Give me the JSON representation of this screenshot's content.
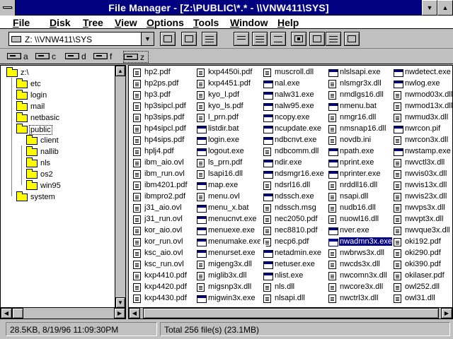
{
  "window": {
    "title": "File Manager - [Z:\\PUBLIC\\*.* - \\\\VNW411\\SYS]"
  },
  "menubar": [
    "File",
    "Disk",
    "Tree",
    "View",
    "Options",
    "Tools",
    "Window",
    "Help"
  ],
  "toolbar": {
    "drive_select_value": "Z: \\\\VNW411\\SYS"
  },
  "drives": [
    "a",
    "c",
    "d",
    "f",
    "z"
  ],
  "tree": [
    {
      "label": "z:\\"
    },
    {
      "label": "etc"
    },
    {
      "label": "login"
    },
    {
      "label": "mail"
    },
    {
      "label": "netbasic"
    },
    {
      "label": "public"
    },
    {
      "label": "client"
    },
    {
      "label": "nallib"
    },
    {
      "label": "nls"
    },
    {
      "label": "os2"
    },
    {
      "label": "win95"
    },
    {
      "label": "system"
    }
  ],
  "files": [
    [
      "hp2.pdf",
      "hp2ps.pdf",
      "hp3.pdf",
      "hp3sipcl.pdf",
      "hp3sips.pdf",
      "hp4sipcl.pdf",
      "hp4sips.pdf",
      "hplj4.pdf",
      "ibm_aio.ovl",
      "ibm_run.ovl",
      "ibm4201.pdf",
      "ibmpro2.pdf",
      "j31_aio.ovl",
      "j31_run.ovl",
      "kor_aio.ovl",
      "kor_run.ovl",
      "ksc_aio.ovl",
      "ksc_run.ovl",
      "kxp4410.pdf",
      "kxp4420.pdf",
      "kxp4430.pdf"
    ],
    [
      "kxp4450i.pdf",
      "kxp4451.pdf",
      "kyo_l.pdf",
      "kyo_ls.pdf",
      "l_prn.pdf",
      "listdir.bat",
      "login.exe",
      "logout.exe",
      "ls_prn.pdf",
      "lsapi16.dll",
      "map.exe",
      "menu.ovl",
      "menu_x.bat",
      "menucnvt.exe",
      "menuexe.exe",
      "menumake.exe",
      "menurset.exe",
      "migeng3x.dll",
      "miglib3x.dll",
      "migsnp3x.dll",
      "migwin3x.exe"
    ],
    [
      "muscroll.dll",
      "nal.exe",
      "nalw31.exe",
      "nalw95.exe",
      "ncopy.exe",
      "ncupdate.exe",
      "ndbcnvt.exe",
      "ndbcomm.dll",
      "ndir.exe",
      "ndsmgr16.exe",
      "ndsrl16.dll",
      "ndssch.exe",
      "ndssch.msg",
      "nec2050.pdf",
      "nec8810.pdf",
      "necp6.pdf",
      "netadmin.exe",
      "netuser.exe",
      "nlist.exe",
      "nls.dll",
      "nlsapi.dll"
    ],
    [
      "nlslsapi.exe",
      "nlsmgr3x.dll",
      "nmdlgs16.dll",
      "nmenu.bat",
      "nmgr16.dll",
      "nmsnap16.dll",
      "novdb.ini",
      "npath.exe",
      "nprint.exe",
      "nprinter.exe",
      "nrddll16.dll",
      "nsapi.dll",
      "nudb16.dll",
      "nuowl16.dll",
      "nver.exe",
      "nwadmn3x.exe",
      "nwbrws3x.dll",
      "nwcds3x.dll",
      "nwcomn3x.dll",
      "nwcore3x.dll",
      "nwctrl3x.dll"
    ],
    [
      "nwdetect.exe",
      "nwlog.exe",
      "nwmod03x.dll",
      "nwmod13x.dll",
      "nwmud3x.dll",
      "nwrcon.pif",
      "nwrcon3x.dll",
      "nwstamp.exe",
      "nwvctl3x.dll",
      "nwvis03x.dll",
      "nwvis13x.dll",
      "nwvis23x.dll",
      "nwvps3x.dll",
      "nwvpt3x.dll",
      "nwvque3x.dll",
      "oki192.pdf",
      "oki290.pdf",
      "oki390.pdf",
      "okilaser.pdf",
      "owl252.dll",
      "owl31.dll"
    ]
  ],
  "status": {
    "selection": "28.5KB, 8/19/96 11:09:30PM",
    "total": "Total 256 file(s) (23.1MB)"
  }
}
